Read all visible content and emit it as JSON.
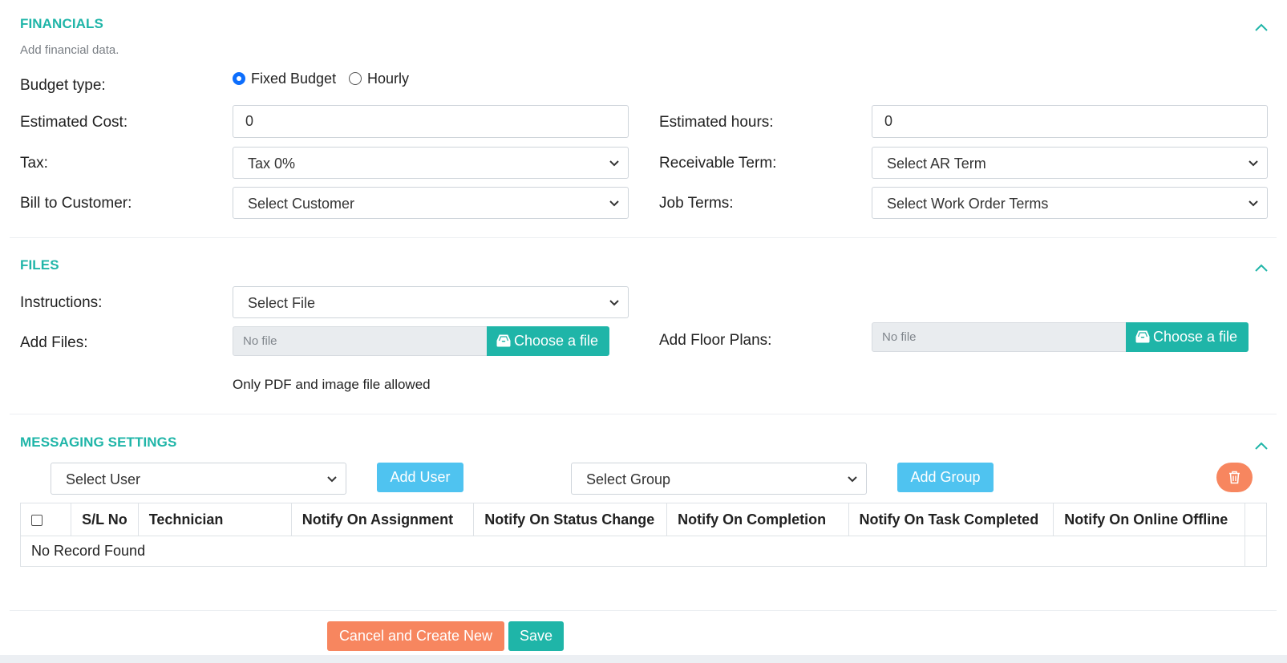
{
  "financials": {
    "title": "FINANCIALS",
    "subtitle": "Add financial data.",
    "budget_type_label": "Budget type:",
    "budget_options": [
      {
        "label": "Fixed Budget",
        "checked": true
      },
      {
        "label": "Hourly",
        "checked": false
      }
    ],
    "estimated_cost_label": "Estimated Cost:",
    "estimated_cost_value": "0",
    "estimated_hours_label": "Estimated hours:",
    "estimated_hours_value": "0",
    "tax_label": "Tax:",
    "tax_value": "Tax 0%",
    "receivable_term_label": "Receivable Term:",
    "receivable_term_value": "Select AR Term",
    "bill_to_label": "Bill to Customer:",
    "bill_to_value": "Select Customer",
    "job_terms_label": "Job Terms:",
    "job_terms_value": "Select Work Order Terms"
  },
  "files": {
    "title": "FILES",
    "instructions_label": "Instructions:",
    "instructions_value": "Select File",
    "add_files_label": "Add Files:",
    "add_files_placeholder": "No file",
    "add_floor_plans_label": "Add Floor Plans:",
    "floor_plans_placeholder": "No file",
    "choose_file_label": "Choose a file",
    "hint": "Only PDF and image file allowed"
  },
  "messaging": {
    "title": "MESSAGING SETTINGS",
    "select_user": "Select User",
    "add_user": "Add User",
    "select_group": "Select Group",
    "add_group": "Add Group",
    "columns": [
      "S/L No",
      "Technician",
      "Notify On Assignment",
      "Notify On Status Change",
      "Notify On Completion",
      "Notify On Task Completed",
      "Notify On Online Offline"
    ],
    "empty_text": "No Record Found"
  },
  "actions": {
    "cancel_create_new": "Cancel and Create New",
    "save": "Save"
  },
  "colors": {
    "accent_teal": "#1fb5a8",
    "accent_blue": "#4fc3f0",
    "accent_orange": "#f7865f",
    "radio_blue": "#0d6efd"
  },
  "icons": {
    "collapse": "chevron-up-icon",
    "select": "chevron-down-icon",
    "file": "inbox-tray-icon",
    "delete": "trash-icon"
  }
}
